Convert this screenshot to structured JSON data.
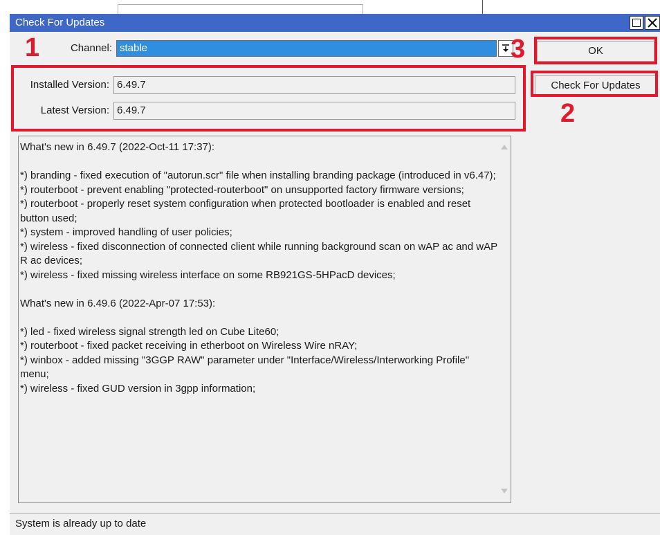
{
  "window": {
    "title": "Check For Updates"
  },
  "channel": {
    "label": "Channel:",
    "value": "stable"
  },
  "versions": {
    "installed_label": "Installed Version:",
    "installed_value": "6.49.7",
    "latest_label": "Latest Version:",
    "latest_value": "6.49.7"
  },
  "buttons": {
    "ok_label": "OK",
    "check_label": "Check For Updates"
  },
  "annotations": {
    "n1": "1",
    "n2": "2",
    "n3": "3",
    "color": "#e0192c"
  },
  "release_notes": "What's new in 6.49.7 (2022-Oct-11 17:37):\n\n*) branding - fixed execution of \"autorun.scr\" file when installing branding package (introduced in v6.47);\n*) routerboot - prevent enabling \"protected-routerboot\" on unsupported factory firmware versions;\n*) routerboot - properly reset system configuration when protected bootloader is enabled and reset button used;\n*) system - improved handling of user policies;\n*) wireless - fixed disconnection of connected client while running background scan on wAP ac and wAP R ac devices;\n*) wireless - fixed missing wireless interface on some RB921GS-5HPacD devices;\n\nWhat's new in 6.49.6 (2022-Apr-07 17:53):\n\n*) led - fixed wireless signal strength led on Cube Lite60;\n*) routerboot - fixed packet receiving in etherboot on Wireless Wire nRAY;\n*) winbox - added missing \"3GGP RAW\" parameter under \"Interface/Wireless/Interworking Profile\" menu;\n*) wireless - fixed GUD version in 3gpp information;",
  "status": {
    "text": "System is already up to date"
  },
  "colors": {
    "titlebar": "#3f67c8",
    "selection": "#2f8ee0"
  }
}
